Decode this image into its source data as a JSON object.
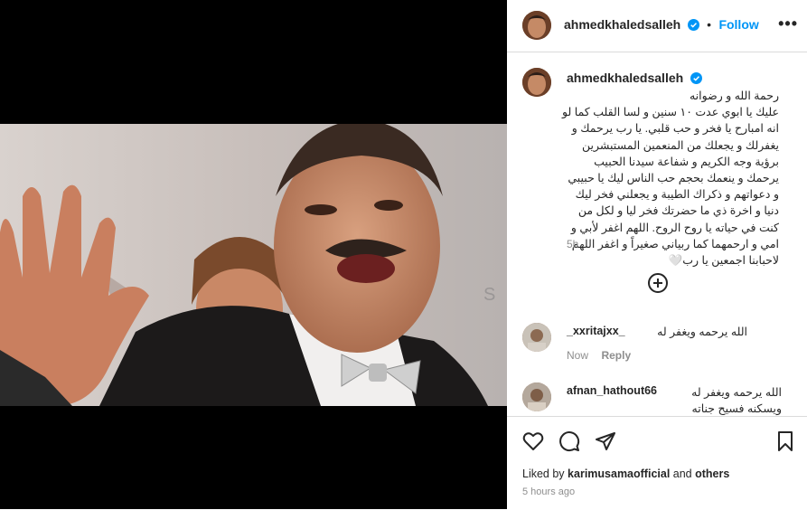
{
  "post": {
    "author": "ahmedkhaledsalleh",
    "follow_label": "Follow",
    "dot": "•",
    "more_label": "•••",
    "caption": "رحمة الله و رضوانه\nعليك يا ابوي عدت ١٠ سنين و لسا القلب كما لو انه امبارح يا فخر و حب قلبي. يا رب يرحمك و يغفرلك و يجعلك من المنعمين المستبشرين برؤية وجه الكريم و شفاعة سيدنا الحبيب يرحمك و ينعمك بحجم حب الناس ليك يا حبيبي و دعواتهم و ذكراك الطيبة و يجعلني فخر ليك دنيا و اخرة ذي ما حضرتك فخر ليا و لكل من كنت في حياته يا روح الروح. اللهم اغفر لأبي و امي و ارحمهما كما ربياني صغيراً و اغفر اللهم لاحبابنا اجمعين يا رب🤍",
    "caption_time": "5h"
  },
  "comments": [
    {
      "username": "_xxritajxx_",
      "text": "الله يرحمه ويغفر له",
      "time": "Now",
      "reply_label": "Reply"
    },
    {
      "username": "afnan_hathout66",
      "text": "الله يرحمه ويغفر له ويسكنه فسيح جناته يارب"
    }
  ],
  "likes": {
    "prefix": "Liked by",
    "user": "karimusamaofficial",
    "suffix": "and",
    "others": "others"
  },
  "timestamp": "5 hours ago",
  "colors": {
    "accent": "#0095f6",
    "verified": "#0095f6",
    "border": "#dbdbdb",
    "muted": "#8e8e8e"
  }
}
